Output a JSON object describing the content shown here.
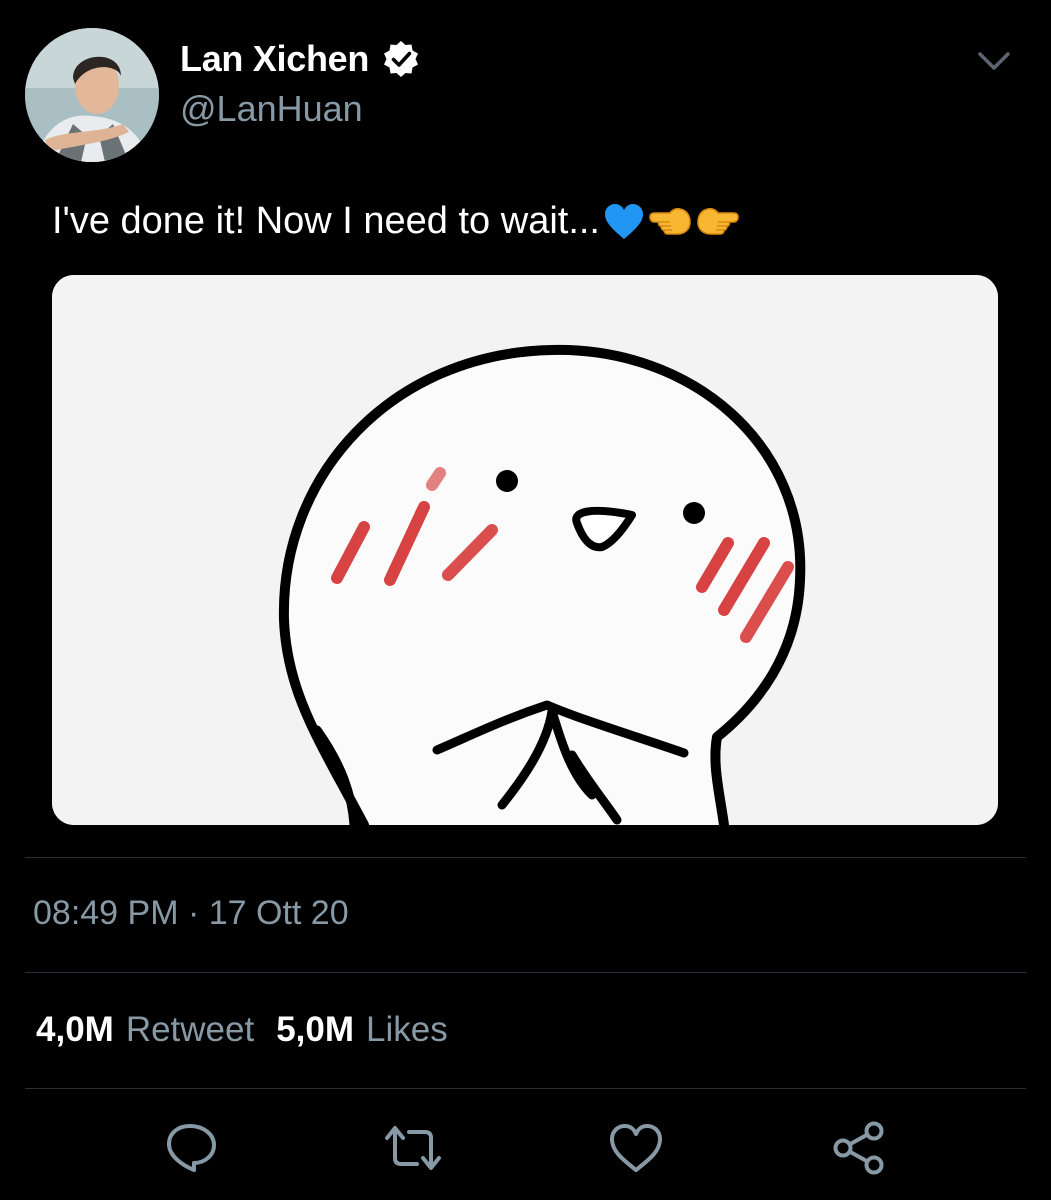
{
  "user": {
    "display_name": "Lan Xichen",
    "handle": "@LanHuan",
    "verified": true,
    "avatar": "profile-photo"
  },
  "tweet": {
    "text": "I've done it! Now I need to wait...",
    "emojis": [
      "blue-heart",
      "backhand-index-pointing-left",
      "backhand-index-pointing-right"
    ],
    "media": "cartoon-blushing-face-image",
    "timestamp": "08:49 PM · 17 Ott 20"
  },
  "stats": {
    "retweets_count": "4,0M",
    "retweets_label": "Retweet",
    "likes_count": "5,0M",
    "likes_label": "Likes"
  },
  "actions": [
    "reply-icon",
    "retweet-icon",
    "like-icon",
    "share-icon"
  ],
  "colors": {
    "background": "#000000",
    "text": "#ffffff",
    "secondary_text": "#8899a6",
    "verified_badge": "#ffffff",
    "divider": "#2a2e33",
    "heart_emoji": "#2196f3"
  }
}
